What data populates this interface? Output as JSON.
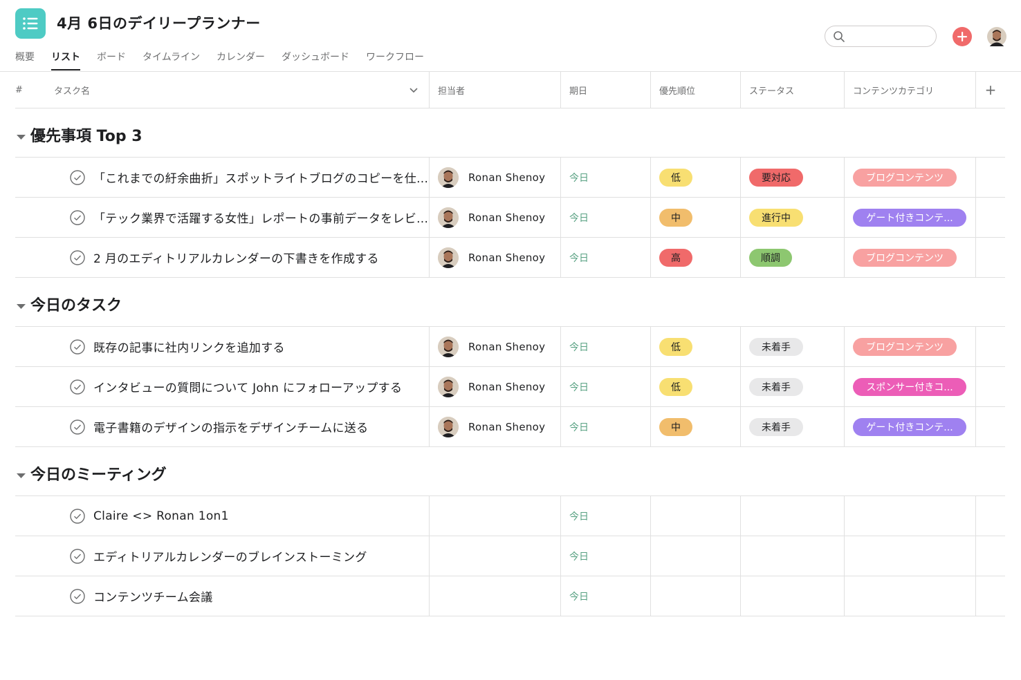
{
  "header": {
    "title": "4月 6日のデイリープランナー",
    "tabs": [
      "概要",
      "リスト",
      "ボード",
      "タイムライン",
      "カレンダー",
      "ダッシュボード",
      "ワークフロー"
    ],
    "active_tab": "リスト",
    "search_placeholder": ""
  },
  "columns": {
    "num": "#",
    "name": "タスク名",
    "assignee": "担当者",
    "due": "期日",
    "priority": "優先順位",
    "status": "ステータス",
    "category": "コンテンツカテゴリ",
    "add": "+"
  },
  "sections": [
    {
      "title": "優先事項 Top 3",
      "rows": [
        {
          "name": "「これまでの紆余曲折」スポットライトブログのコピーを仕...",
          "assignee": "Ronan Shenoy",
          "due": "今日",
          "priority": "低",
          "status": "要対応",
          "category": "ブログコンテンツ"
        },
        {
          "name": "「テック業界で活躍する女性」レポートの事前データをレビ...",
          "assignee": "Ronan Shenoy",
          "due": "今日",
          "priority": "中",
          "status": "進行中",
          "category": "ゲート付きコンテ..."
        },
        {
          "name": "2 月のエディトリアルカレンダーの下書きを作成する",
          "assignee": "Ronan Shenoy",
          "due": "今日",
          "priority": "高",
          "status": "順調",
          "category": "ブログコンテンツ"
        }
      ]
    },
    {
      "title": "今日のタスク",
      "rows": [
        {
          "name": "既存の記事に社内リンクを追加する",
          "assignee": "Ronan Shenoy",
          "due": "今日",
          "priority": "低",
          "status": "未着手",
          "category": "ブログコンテンツ"
        },
        {
          "name": "インタビューの質問について John にフォローアップする",
          "assignee": "Ronan Shenoy",
          "due": "今日",
          "priority": "低",
          "status": "未着手",
          "category": "スポンサー付きコ..."
        },
        {
          "name": "電子書籍のデザインの指示をデザインチームに送る",
          "assignee": "Ronan Shenoy",
          "due": "今日",
          "priority": "中",
          "status": "未着手",
          "category": "ゲート付きコンテ..."
        }
      ]
    },
    {
      "title": "今日のミーティング",
      "rows": [
        {
          "name": "Claire <> Ronan 1on1",
          "due": "今日"
        },
        {
          "name": "エディトリアルカレンダーのブレインストーミング",
          "due": "今日"
        },
        {
          "name": "コンテンツチーム会議",
          "due": "今日"
        }
      ]
    }
  ],
  "colors": {
    "app_icon": "#4ecbc4",
    "add_button": "#f06a6a",
    "due_today": "#58a182",
    "priority_low": "#f8df72",
    "priority_mid": "#f1bd6c",
    "priority_high": "#f06a6a",
    "status_needs_action": "#f06a6a",
    "status_in_progress": "#f8df72",
    "status_on_track": "#8dc770",
    "status_not_started": "#e8e8e9",
    "category_blog": "#f8a1a1",
    "category_gated": "#9f81f0",
    "category_sponsored": "#ec5db7"
  }
}
